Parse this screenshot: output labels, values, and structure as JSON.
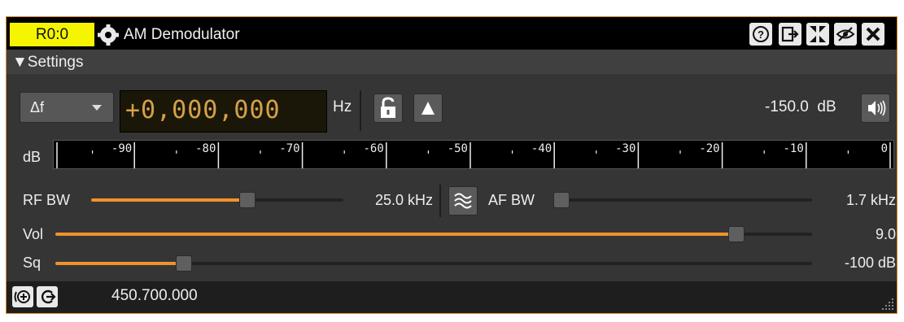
{
  "window": {
    "badge": "R0:0",
    "title": "AM Demodulator",
    "settings_label": "▼Settings"
  },
  "controls": {
    "delta_mode": "Δf",
    "offset_digits": "+0,000,000",
    "unit": "Hz",
    "power": "-150.0  dB"
  },
  "meter": {
    "label": "dB",
    "ticks": [
      "-90",
      "-80",
      "-70",
      "-60",
      "-50",
      "-40",
      "-30",
      "-20",
      "-10",
      "0"
    ]
  },
  "sliders": {
    "rf_bw": {
      "label": "RF BW",
      "value": "25.0 kHz",
      "level": 0.62
    },
    "af_bw": {
      "label": "AF BW",
      "value": "1.7 kHz",
      "level": 0.03
    },
    "vol": {
      "label": "Vol",
      "value": "9.0",
      "level": 0.9
    },
    "sq": {
      "label": "Sq",
      "value": "-100 dB",
      "level": 0.17
    }
  },
  "status": {
    "frequency": "450.700.000"
  },
  "colors": {
    "accent": "#f0922b",
    "badge": "#f5f500",
    "frame": "#d98a28",
    "digits": "#d6a04a"
  },
  "icons": [
    "gear-icon",
    "help-icon",
    "move-out-icon",
    "shrink-icon",
    "hide-icon",
    "close-icon",
    "lock-icon",
    "peak-icon",
    "speaker-icon",
    "filter-icon",
    "target-icon",
    "relative-icon",
    "resize-grip-icon"
  ]
}
